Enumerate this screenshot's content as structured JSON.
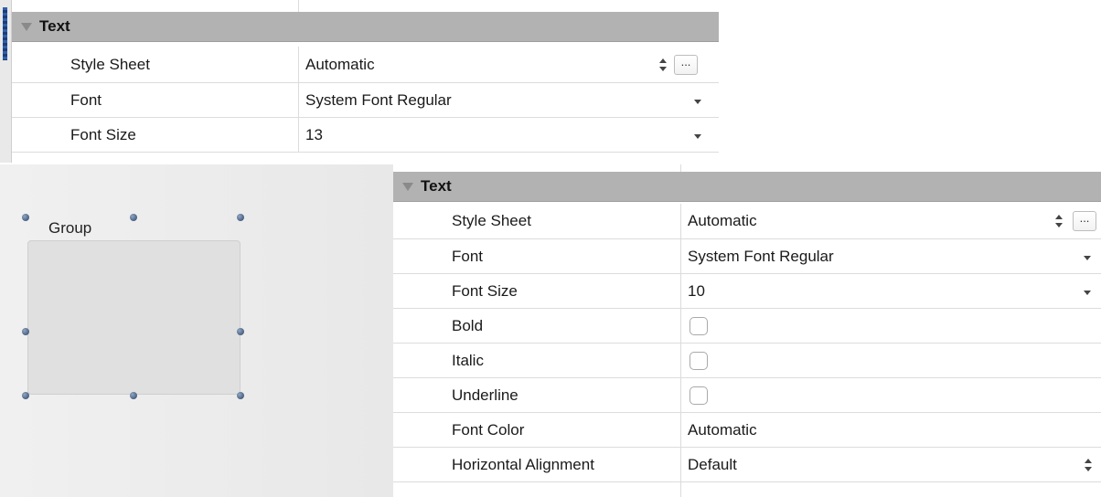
{
  "top_inspector": {
    "section_title": "Text",
    "rows": [
      {
        "label": "Style Sheet",
        "value": "Automatic",
        "control": "stepper-with-ellipsis",
        "ellipsis_label": "..."
      },
      {
        "label": "Font",
        "value": "System Font Regular",
        "control": "dropdown"
      },
      {
        "label": "Font Size",
        "value": "13",
        "control": "dropdown"
      }
    ]
  },
  "canvas": {
    "group_label": "Group"
  },
  "bottom_inspector": {
    "section_title": "Text",
    "rows": [
      {
        "label": "Style Sheet",
        "value": "Automatic",
        "control": "stepper-with-ellipsis",
        "ellipsis_label": "..."
      },
      {
        "label": "Font",
        "value": "System Font Regular",
        "control": "dropdown"
      },
      {
        "label": "Font Size",
        "value": "10",
        "control": "dropdown"
      },
      {
        "label": "Bold",
        "value": "",
        "control": "checkbox",
        "checked": false
      },
      {
        "label": "Italic",
        "value": "",
        "control": "checkbox",
        "checked": false
      },
      {
        "label": "Underline",
        "value": "",
        "control": "checkbox",
        "checked": false
      },
      {
        "label": "Font Color",
        "value": "Automatic",
        "control": "text"
      },
      {
        "label": "Horizontal Alignment",
        "value": "Default",
        "control": "stepper"
      }
    ]
  },
  "colors": {
    "section_header_bg": "#b2b2b2",
    "selection_handle": "#4a5f80",
    "selection_bar": "#2f5fa8"
  }
}
